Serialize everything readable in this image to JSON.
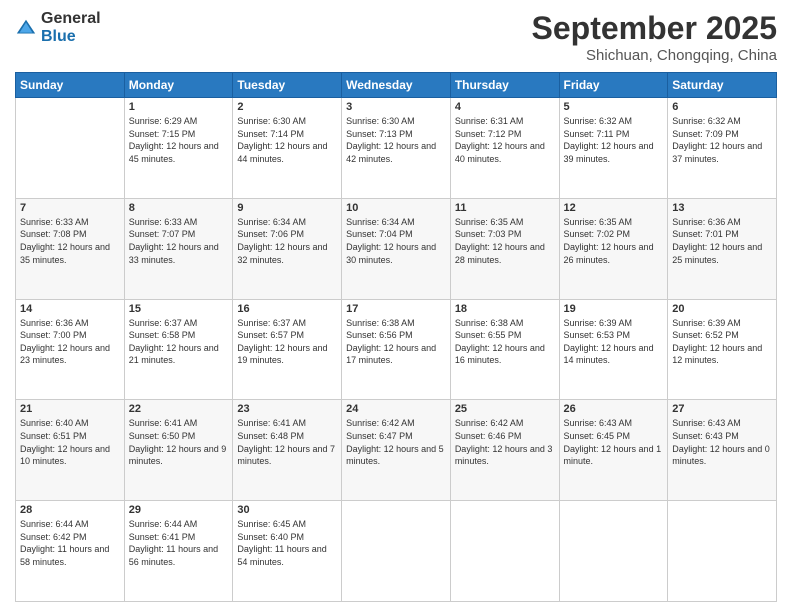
{
  "logo": {
    "general": "General",
    "blue": "Blue"
  },
  "title": {
    "month": "September 2025",
    "location": "Shichuan, Chongqing, China"
  },
  "days_header": [
    "Sunday",
    "Monday",
    "Tuesday",
    "Wednesday",
    "Thursday",
    "Friday",
    "Saturday"
  ],
  "weeks": [
    [
      {
        "day": "",
        "info": ""
      },
      {
        "day": "1",
        "info": "Sunrise: 6:29 AM\nSunset: 7:15 PM\nDaylight: 12 hours and 45 minutes."
      },
      {
        "day": "2",
        "info": "Sunrise: 6:30 AM\nSunset: 7:14 PM\nDaylight: 12 hours and 44 minutes."
      },
      {
        "day": "3",
        "info": "Sunrise: 6:30 AM\nSunset: 7:13 PM\nDaylight: 12 hours and 42 minutes."
      },
      {
        "day": "4",
        "info": "Sunrise: 6:31 AM\nSunset: 7:12 PM\nDaylight: 12 hours and 40 minutes."
      },
      {
        "day": "5",
        "info": "Sunrise: 6:32 AM\nSunset: 7:11 PM\nDaylight: 12 hours and 39 minutes."
      },
      {
        "day": "6",
        "info": "Sunrise: 6:32 AM\nSunset: 7:09 PM\nDaylight: 12 hours and 37 minutes."
      }
    ],
    [
      {
        "day": "7",
        "info": "Sunrise: 6:33 AM\nSunset: 7:08 PM\nDaylight: 12 hours and 35 minutes."
      },
      {
        "day": "8",
        "info": "Sunrise: 6:33 AM\nSunset: 7:07 PM\nDaylight: 12 hours and 33 minutes."
      },
      {
        "day": "9",
        "info": "Sunrise: 6:34 AM\nSunset: 7:06 PM\nDaylight: 12 hours and 32 minutes."
      },
      {
        "day": "10",
        "info": "Sunrise: 6:34 AM\nSunset: 7:04 PM\nDaylight: 12 hours and 30 minutes."
      },
      {
        "day": "11",
        "info": "Sunrise: 6:35 AM\nSunset: 7:03 PM\nDaylight: 12 hours and 28 minutes."
      },
      {
        "day": "12",
        "info": "Sunrise: 6:35 AM\nSunset: 7:02 PM\nDaylight: 12 hours and 26 minutes."
      },
      {
        "day": "13",
        "info": "Sunrise: 6:36 AM\nSunset: 7:01 PM\nDaylight: 12 hours and 25 minutes."
      }
    ],
    [
      {
        "day": "14",
        "info": "Sunrise: 6:36 AM\nSunset: 7:00 PM\nDaylight: 12 hours and 23 minutes."
      },
      {
        "day": "15",
        "info": "Sunrise: 6:37 AM\nSunset: 6:58 PM\nDaylight: 12 hours and 21 minutes."
      },
      {
        "day": "16",
        "info": "Sunrise: 6:37 AM\nSunset: 6:57 PM\nDaylight: 12 hours and 19 minutes."
      },
      {
        "day": "17",
        "info": "Sunrise: 6:38 AM\nSunset: 6:56 PM\nDaylight: 12 hours and 17 minutes."
      },
      {
        "day": "18",
        "info": "Sunrise: 6:38 AM\nSunset: 6:55 PM\nDaylight: 12 hours and 16 minutes."
      },
      {
        "day": "19",
        "info": "Sunrise: 6:39 AM\nSunset: 6:53 PM\nDaylight: 12 hours and 14 minutes."
      },
      {
        "day": "20",
        "info": "Sunrise: 6:39 AM\nSunset: 6:52 PM\nDaylight: 12 hours and 12 minutes."
      }
    ],
    [
      {
        "day": "21",
        "info": "Sunrise: 6:40 AM\nSunset: 6:51 PM\nDaylight: 12 hours and 10 minutes."
      },
      {
        "day": "22",
        "info": "Sunrise: 6:41 AM\nSunset: 6:50 PM\nDaylight: 12 hours and 9 minutes."
      },
      {
        "day": "23",
        "info": "Sunrise: 6:41 AM\nSunset: 6:48 PM\nDaylight: 12 hours and 7 minutes."
      },
      {
        "day": "24",
        "info": "Sunrise: 6:42 AM\nSunset: 6:47 PM\nDaylight: 12 hours and 5 minutes."
      },
      {
        "day": "25",
        "info": "Sunrise: 6:42 AM\nSunset: 6:46 PM\nDaylight: 12 hours and 3 minutes."
      },
      {
        "day": "26",
        "info": "Sunrise: 6:43 AM\nSunset: 6:45 PM\nDaylight: 12 hours and 1 minute."
      },
      {
        "day": "27",
        "info": "Sunrise: 6:43 AM\nSunset: 6:43 PM\nDaylight: 12 hours and 0 minutes."
      }
    ],
    [
      {
        "day": "28",
        "info": "Sunrise: 6:44 AM\nSunset: 6:42 PM\nDaylight: 11 hours and 58 minutes."
      },
      {
        "day": "29",
        "info": "Sunrise: 6:44 AM\nSunset: 6:41 PM\nDaylight: 11 hours and 56 minutes."
      },
      {
        "day": "30",
        "info": "Sunrise: 6:45 AM\nSunset: 6:40 PM\nDaylight: 11 hours and 54 minutes."
      },
      {
        "day": "",
        "info": ""
      },
      {
        "day": "",
        "info": ""
      },
      {
        "day": "",
        "info": ""
      },
      {
        "day": "",
        "info": ""
      }
    ]
  ]
}
